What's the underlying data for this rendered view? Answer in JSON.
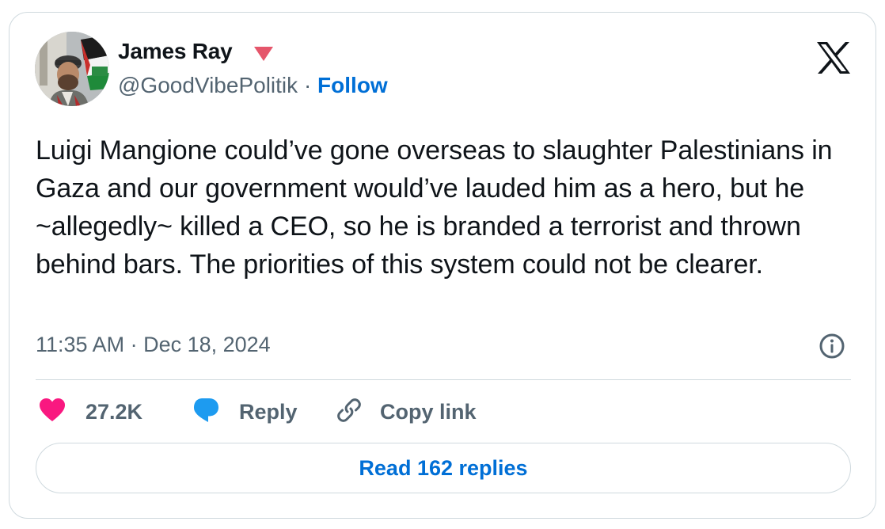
{
  "author": {
    "name": "James Ray",
    "handle": "@GoodVibePolitik",
    "separator": "·",
    "follow_label": "Follow",
    "badge_icon": "triangle-down-icon",
    "badge_color": "#e5566b"
  },
  "tweet": {
    "text": "Luigi Mangione could’ve gone overseas to slaughter Palestinians in Gaza and our government would’ve lauded him as a hero, but he ~allegedly~ killed a CEO, so he is branded a terrorist and thrown behind bars. The priorities of this system could not be clearer.",
    "timestamp": "11:35 AM · Dec 18, 2024"
  },
  "actions": {
    "likes": "27.2K",
    "reply_label": "Reply",
    "copy_link_label": "Copy link"
  },
  "read_replies_label": "Read 162 replies",
  "colors": {
    "like": "#f91880",
    "reply": "#1d9bf0",
    "link": "#006fd6",
    "muted": "#536471",
    "border": "#cfd9de"
  },
  "icons": [
    "x-logo-icon",
    "info-icon",
    "heart-icon",
    "reply-bubble-icon",
    "link-icon"
  ]
}
